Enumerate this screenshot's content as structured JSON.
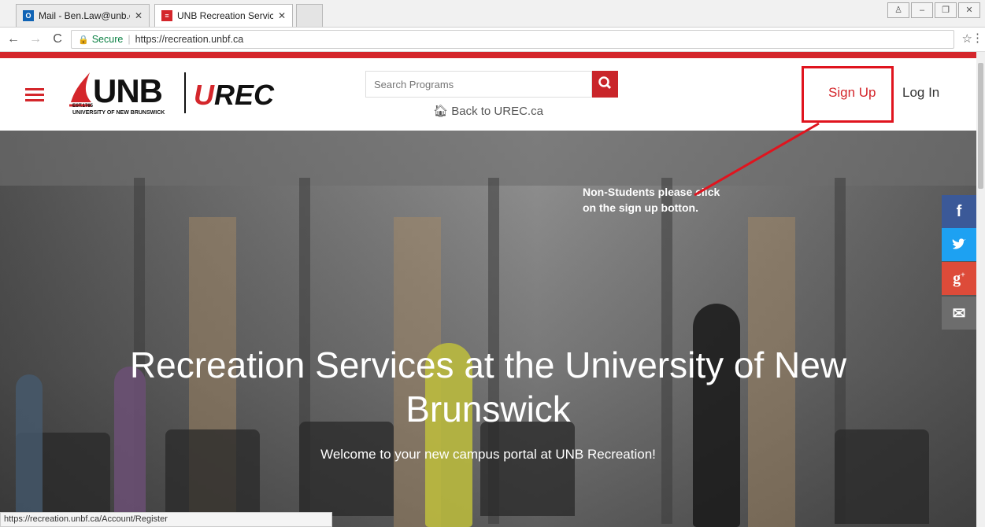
{
  "browser": {
    "tabs": [
      {
        "label": "Mail - Ben.Law@unb.ca",
        "favicon": "outlook-icon",
        "color": "#0f63b5"
      },
      {
        "label": "UNB Recreation Services",
        "favicon": "urec-favicon",
        "color": "#d4262b"
      }
    ],
    "address": {
      "secure_label": "Secure",
      "url": "https://recreation.unbf.ca"
    },
    "status_url": "https://recreation.unbf.ca/Account/Register"
  },
  "header": {
    "logo": {
      "unb": "UNB",
      "est": "EST.1785",
      "university": "UNIVERSITY OF NEW BRUNSWICK",
      "urec_u": "U",
      "urec_rest": "REC"
    },
    "search_placeholder": "Search Programs",
    "back_link": "Back to UREC.ca",
    "signup": "Sign Up",
    "login": "Log In"
  },
  "hero": {
    "annotation": "Non-Students please click on the sign up botton.",
    "title": "Recreation Services at the University of New Brunswick",
    "subtitle": "Welcome to your new campus portal at UNB Recreation!"
  },
  "share": [
    {
      "icon": "facebook-icon",
      "glyph": "f",
      "color": "#3b5998"
    },
    {
      "icon": "twitter-icon",
      "glyph": "t",
      "color": "#1da1f2"
    },
    {
      "icon": "google-plus-icon",
      "glyph": "g+",
      "color": "#dd4b39"
    },
    {
      "icon": "email-icon",
      "glyph": "✉",
      "color": "#6d6d6d"
    }
  ],
  "colors": {
    "brand_red": "#d4262b",
    "annotation_red": "#e0141e"
  }
}
